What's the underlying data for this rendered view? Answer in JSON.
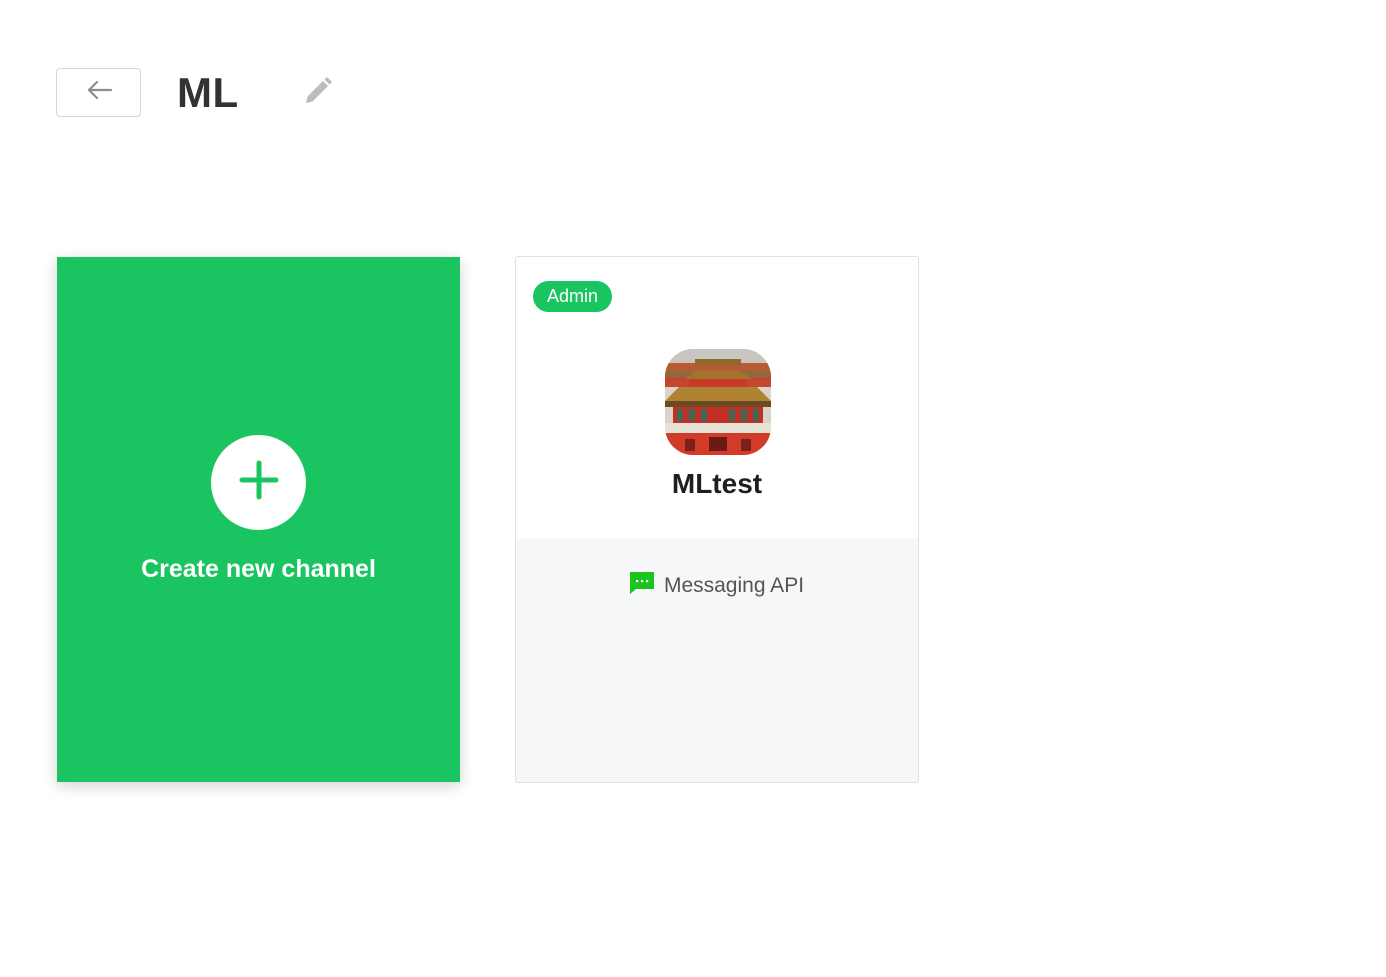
{
  "header": {
    "back_icon": "arrow-left-icon",
    "title": "ML",
    "edit_icon": "pencil-icon"
  },
  "create_card": {
    "icon": "plus-icon",
    "label": "Create new channel"
  },
  "channels": [
    {
      "role": "Admin",
      "name": "MLtest",
      "avatar": "palace-photo",
      "type_icon": "chat-bubble-icon",
      "type_label": "Messaging API"
    }
  ],
  "colors": {
    "brand_green": "#19c461",
    "messaging_icon_green": "#19c41e"
  }
}
